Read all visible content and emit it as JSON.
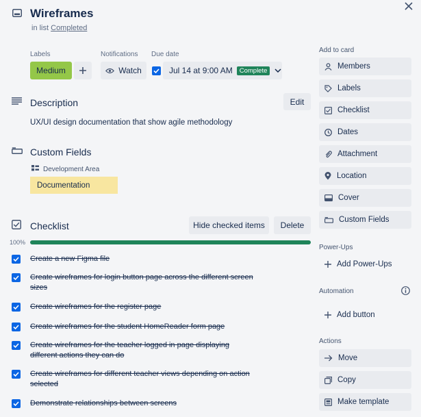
{
  "card": {
    "title": "Wireframes",
    "in_list_prefix": "in list",
    "list_name": "Completed"
  },
  "labels": {
    "heading": "Labels",
    "items": [
      "Medium"
    ],
    "label_color": "#94c748",
    "add_icon": "plus-icon"
  },
  "notifications": {
    "heading": "Notifications",
    "watch_label": "Watch"
  },
  "due_date": {
    "heading": "Due date",
    "value": "Jul 14 at 9:00 AM",
    "status": "Complete",
    "checked": true
  },
  "description": {
    "heading": "Description",
    "edit_label": "Edit",
    "text": "UX/UI design documentation that show agile methodology"
  },
  "custom_fields": {
    "heading": "Custom Fields",
    "field_name": "Development Area",
    "field_value": "Documentation"
  },
  "checklist": {
    "heading": "Checklist",
    "hide_label": "Hide checked items",
    "delete_label": "Delete",
    "progress_text": "100%",
    "progress": 1.0,
    "items": [
      {
        "text": "Create a new Figma file",
        "checked": true
      },
      {
        "text": "Create wireframes for login button page across the different screen sizes",
        "checked": true
      },
      {
        "text": "Create wireframes for the register page",
        "checked": true
      },
      {
        "text": "Create wireframes for the student HomeReader form page",
        "checked": true
      },
      {
        "text": "Create wireframes for the teacher logged in page displaying different actions they can do",
        "checked": true
      },
      {
        "text": "Create wireframes for different teacher views depending on action selected",
        "checked": true
      },
      {
        "text": "Demonstrate relationships between screens",
        "checked": true
      }
    ]
  },
  "sidebar": {
    "add_to_card_heading": "Add to card",
    "add_to_card": [
      {
        "label": "Members",
        "icon": "person-icon"
      },
      {
        "label": "Labels",
        "icon": "tag-icon"
      },
      {
        "label": "Checklist",
        "icon": "checklist-icon"
      },
      {
        "label": "Dates",
        "icon": "clock-icon"
      },
      {
        "label": "Attachment",
        "icon": "paperclip-icon"
      },
      {
        "label": "Location",
        "icon": "pin-icon"
      },
      {
        "label": "Cover",
        "icon": "cover-icon"
      },
      {
        "label": "Custom Fields",
        "icon": "fields-icon"
      }
    ],
    "powerups_heading": "Power-Ups",
    "add_powerups_label": "Add Power-Ups",
    "automation_heading": "Automation",
    "add_button_label": "Add button",
    "actions_heading": "Actions",
    "actions": [
      {
        "label": "Move",
        "icon": "arrow-right-icon"
      },
      {
        "label": "Copy",
        "icon": "copy-icon"
      },
      {
        "label": "Make template",
        "icon": "template-icon"
      }
    ]
  },
  "colors": {
    "accent_blue": "#0c66e4",
    "progress_green": "#1f845a",
    "field_yellow": "#f8e6a0"
  }
}
